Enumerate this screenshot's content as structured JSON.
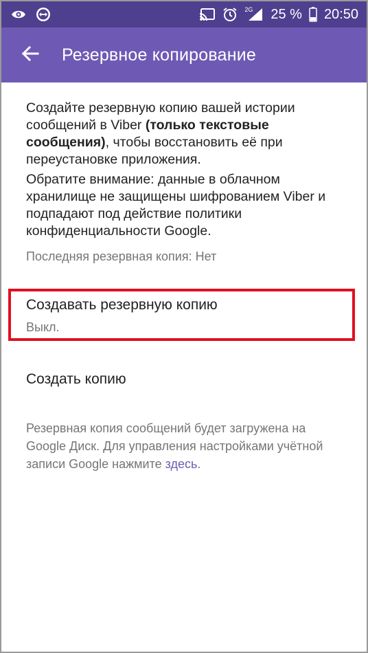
{
  "status_bar": {
    "icons_left": [
      "eye-icon",
      "teamviewer-icon"
    ],
    "icons_right": [
      "cast-icon",
      "alarm-icon",
      "signal-icon",
      "battery-icon"
    ],
    "network": "2G",
    "battery": "25 %",
    "time": "20:50"
  },
  "appbar": {
    "title": "Резервное копирование",
    "back_icon": "arrow-back-icon"
  },
  "description": {
    "p1_start": "Создайте резервную копию вашей истории сообщений в Viber ",
    "p1_bold": "(только текстовые сообщения)",
    "p1_end": ", чтобы восстановить её при переустановке приложения.",
    "p2": "Обратите внимание: данные в облачном хранилище не защищены шифрованием Viber и подпадают под действие политики конфиденциальности Google.",
    "last_backup": "Последняя резервная копия: Нет"
  },
  "settings": {
    "auto_backup": {
      "title": "Создавать резервную копию",
      "value": "Выкл."
    },
    "create_backup": "Создать копию"
  },
  "footer": {
    "text": "Резервная копия сообщений будет загружена на Google Диск. Для управления настройками учётной записи Google нажмите ",
    "link": "здесь",
    "end": "."
  },
  "colors": {
    "statusbar": "#4f3f8f",
    "appbar": "#6e5ab4",
    "highlight": "#e01020",
    "link": "#6e5ab4"
  }
}
